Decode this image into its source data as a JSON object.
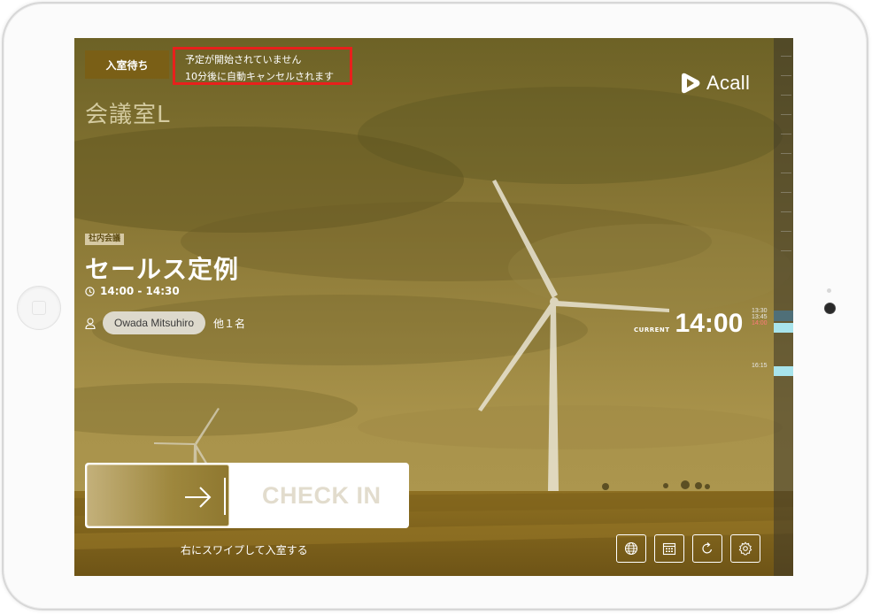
{
  "status": {
    "badge": "入室待ち"
  },
  "notice": {
    "line1": "予定が開始されていません",
    "line2": "10分後に自動キャンセルされます",
    "border_color": "#e8201c"
  },
  "brand": {
    "name": "Acall"
  },
  "room": {
    "name": "会議室L"
  },
  "meeting": {
    "tag": "社内会議",
    "title": "セールス定例",
    "time": "14:00 - 14:30",
    "organizer": "Owada Mitsuhiro",
    "others": "他１名"
  },
  "clock": {
    "label": "CURRENT",
    "time": "14:00"
  },
  "timeline": {
    "labels": [
      "13:30",
      "13:45",
      "14:00",
      "16:15"
    ]
  },
  "checkin": {
    "label": "CHECK IN",
    "hint": "右にスワイプして入室する"
  },
  "toolbar": {
    "buttons": [
      "globe-icon",
      "calendar-icon",
      "refresh-icon",
      "settings-icon"
    ]
  },
  "colors": {
    "overlay": "#7c6a2c",
    "badge": "#7a5f16",
    "timeline_event": "#a8e4ec"
  }
}
